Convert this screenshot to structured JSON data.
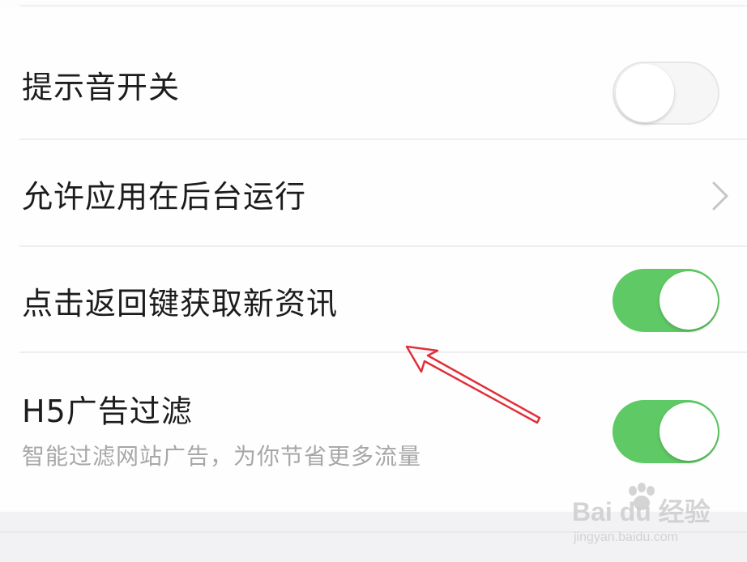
{
  "settings": {
    "items": [
      {
        "label": "提示音开关",
        "control": "toggle",
        "state": "off"
      },
      {
        "label": "允许应用在后台运行",
        "control": "chevron"
      },
      {
        "label": "点击返回键获取新资讯",
        "control": "toggle",
        "state": "on"
      },
      {
        "label": "H5广告过滤",
        "sublabel": "智能过滤网站广告，为你节省更多流量",
        "control": "toggle",
        "state": "on"
      }
    ]
  },
  "colors": {
    "toggle_on": "#5fc965",
    "toggle_off": "#f6f6f7",
    "annotation_arrow": "#e0303a"
  },
  "icons": {
    "chevron": "chevron-right-icon",
    "annotation": "red-arrow-icon"
  },
  "watermark": {
    "main": "Bai du 经验",
    "sub": "jingyan.baidu.com"
  }
}
